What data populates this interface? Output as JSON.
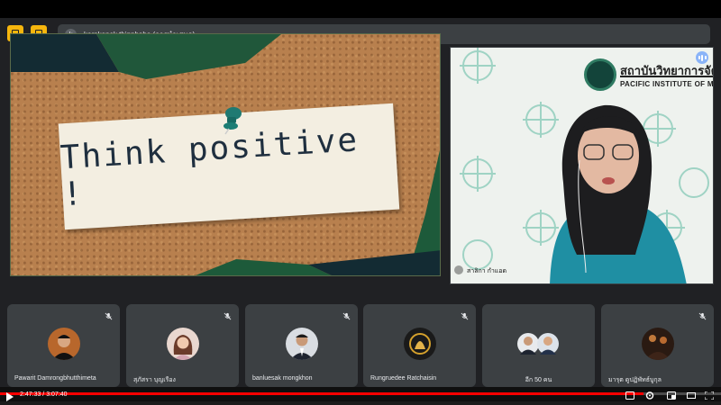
{
  "presenter_bar": {
    "avatar_letter": "k",
    "text": "kornkanok thipphaha (การนำเสนอ)"
  },
  "slide": {
    "note_text": "Think positive !"
  },
  "speaker": {
    "institute_name_th": "สถาบันวิทยาการจัดการ",
    "institute_name_en": "PACIFIC INSTITUTE OF MANA",
    "name": "สาลิกา กำแอด"
  },
  "participants": [
    {
      "name": "Pawarit Damrongbhutthimeta",
      "muted": true
    },
    {
      "name": "สุภัสรา บุญเรือง",
      "muted": true
    },
    {
      "name": "banluesak mongkhon",
      "muted": true
    },
    {
      "name": "Rungruedee Ratchaisin",
      "muted": true
    },
    {
      "name": "อีก 50 คน",
      "muted": false
    },
    {
      "name": "มารุต ดูปฏิพัทธ์บูกุล",
      "muted": true
    }
  ],
  "player": {
    "current_time": "2:47:33",
    "duration": "3:07:40",
    "progress": 0.892
  },
  "colors": {
    "accent_yellow": "#f6b60d",
    "tile_bg": "#3c4043",
    "stage_bg": "#202124",
    "progress_red": "#ff0000"
  }
}
